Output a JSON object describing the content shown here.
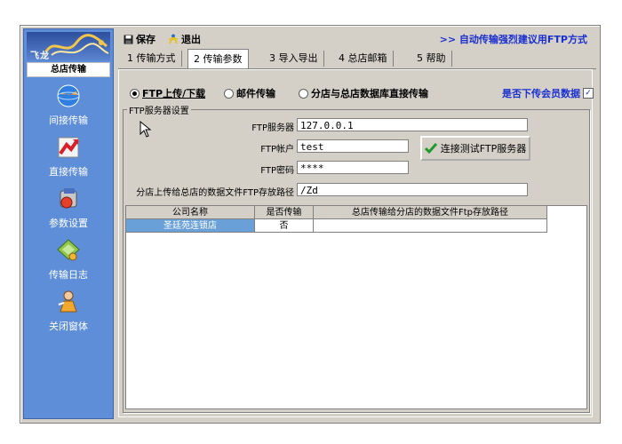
{
  "sidebar": {
    "logo_text": "飞龙",
    "store_label": "总店传输",
    "items": [
      {
        "label": "间接传输",
        "icon": "globe-icon"
      },
      {
        "label": "直接传输",
        "icon": "chart-arrow-icon"
      },
      {
        "label": "参数设置",
        "icon": "settings-drive-icon"
      },
      {
        "label": "传输日志",
        "icon": "log-diamond-icon"
      },
      {
        "label": "关闭窗体",
        "icon": "close-person-icon"
      }
    ]
  },
  "toolbar": {
    "save_label": "保存",
    "exit_label": "退出",
    "advice": ">> 自动传输强烈建议用FTP方式"
  },
  "tabs": [
    {
      "label": "1 传输方式",
      "active": false
    },
    {
      "label": "2 传输参数",
      "active": true
    },
    {
      "label": "3 导入导出",
      "active": false
    },
    {
      "label": "4 总店邮箱",
      "active": false
    },
    {
      "label": "5 帮助",
      "active": false
    }
  ],
  "transfer_options": {
    "ftp": "FTP上传/下载",
    "email": "邮件传输",
    "direct_db": "分店与总店数据库直接传输",
    "selected": "ftp",
    "member_download_label": "是否下传会员数据",
    "member_download_checked": true
  },
  "ftp_settings": {
    "group_title": "FTP服务器设置",
    "server_label": "FTP服务器",
    "server_value": "127.0.0.1",
    "account_label": "FTP帐户",
    "account_value": "test",
    "password_label": "FTP密码",
    "password_value": "****",
    "test_button": "连接测试FTP服务器",
    "path_label": "分店上传给总店的数据文件FTP存放路径",
    "path_value": "/Zd"
  },
  "table": {
    "headers": [
      "公司名称",
      "是否传输",
      "总店传输给分店的数据文件Ftp存放路径"
    ],
    "rows": [
      [
        "圣廷苑连锁店",
        "否",
        ""
      ]
    ]
  },
  "colors": {
    "sidebar_bg": "#5f8ed8",
    "advice_text": "#1a2fd0",
    "selected_cell": "#6aa0d8"
  }
}
